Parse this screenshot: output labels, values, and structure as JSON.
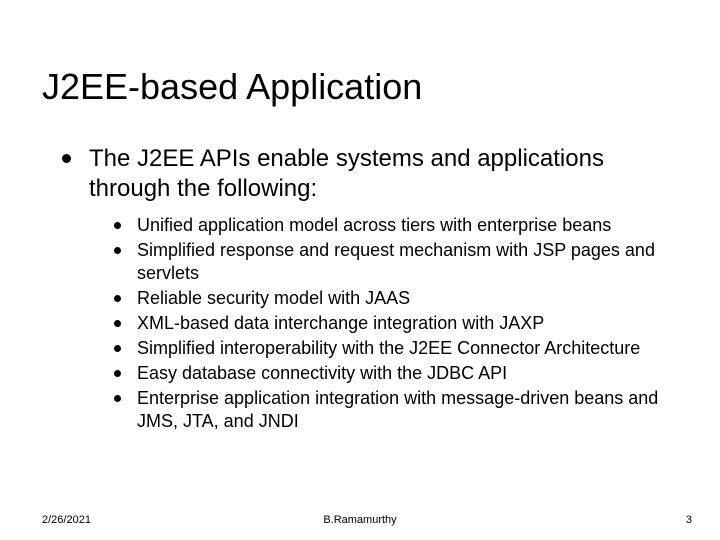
{
  "title": "J2EE-based Application",
  "intro": "The J2EE APIs enable systems and applications through the following:",
  "bullets": [
    "Unified application model across tiers with enterprise beans",
    "Simplified response and request mechanism with JSP pages and servlets",
    "Reliable security model with JAAS",
    "XML-based data interchange integration with JAXP",
    "Simplified interoperability with the J2EE Connector Architecture",
    "Easy database connectivity with the JDBC API",
    "Enterprise application integration with message-driven beans and JMS, JTA, and JNDI"
  ],
  "footer": {
    "date": "2/26/2021",
    "author": "B.Ramamurthy",
    "page": "3"
  }
}
